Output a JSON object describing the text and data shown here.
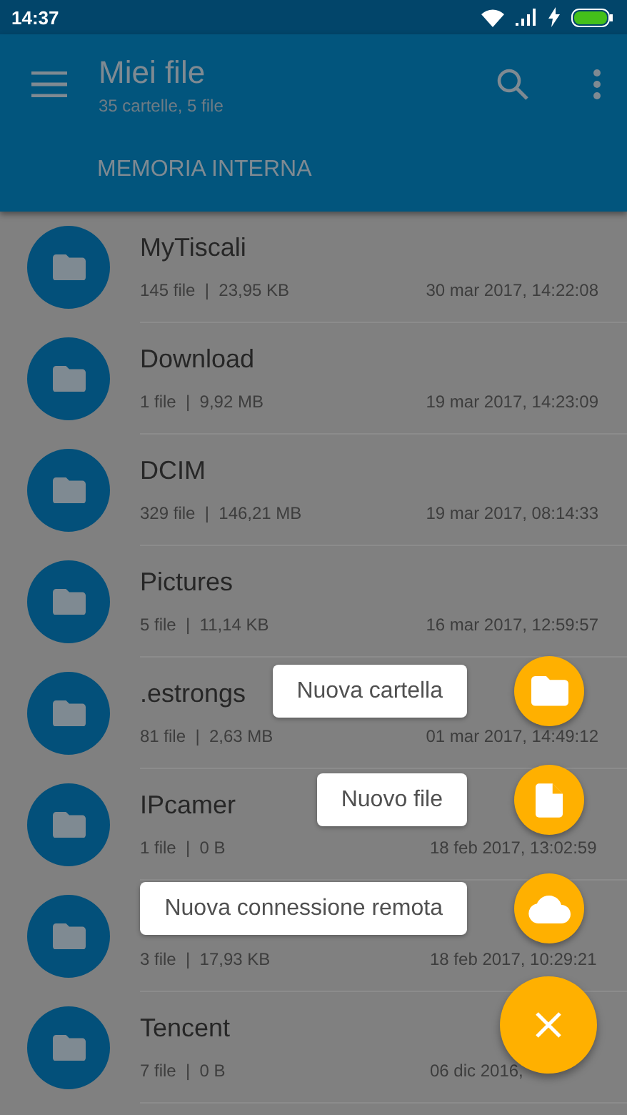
{
  "status_bar": {
    "time": "14:37"
  },
  "app_bar": {
    "title": "Miei file",
    "subtitle": "35 cartelle, 5 file"
  },
  "tabs": [
    {
      "label": "MEMORIA INTERNA",
      "selected": true
    }
  ],
  "folders": [
    {
      "name": "MyTiscali",
      "info": "145 file  |  23,95 KB",
      "date": "30 mar 2017, 14:22:08"
    },
    {
      "name": "Download",
      "info": "1 file  |  9,92 MB",
      "date": "19 mar 2017, 14:23:09"
    },
    {
      "name": "DCIM",
      "info": "329 file  |  146,21 MB",
      "date": "19 mar 2017, 08:14:33"
    },
    {
      "name": "Pictures",
      "info": "5 file  |  11,14 KB",
      "date": "16 mar 2017, 12:59:57"
    },
    {
      "name": ".estrongs",
      "info": "81 file  |  2,63 MB",
      "date": "01 mar 2017, 14:49:12"
    },
    {
      "name": "IPcamer",
      "info": "1 file  |  0 B",
      "date": "18 feb 2017, 13:02:59"
    },
    {
      "info": "3 file  |  17,93 KB",
      "date": "18 feb 2017, 10:29:21"
    },
    {
      "name": "Tencent",
      "info": "7 file  |  0 B",
      "date": "06 dic 2016,"
    }
  ],
  "fab_menu": {
    "expanded": true,
    "actions": [
      {
        "kind": "folder",
        "label": "Nuova cartella"
      },
      {
        "kind": "file",
        "label": "Nuovo file"
      },
      {
        "kind": "cloud",
        "label": "Nuova connessione remota"
      }
    ]
  }
}
